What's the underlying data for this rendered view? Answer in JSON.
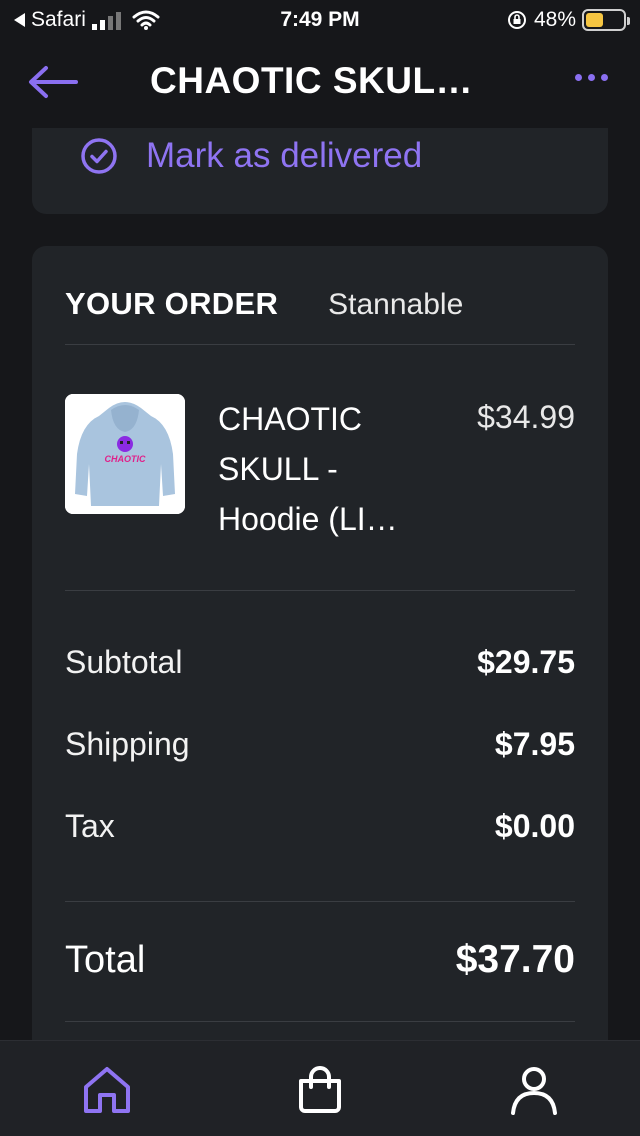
{
  "status_bar": {
    "back_app": "Safari",
    "time": "7:49 PM",
    "battery": "48%",
    "battery_level": 0.48
  },
  "nav": {
    "title": "CHAOTIC SKUL…",
    "back_icon": "arrow-left-icon",
    "more_icon": "more-dots-icon"
  },
  "delivery": {
    "mark_delivered_label": "Mark as delivered",
    "icon": "check-circle-icon"
  },
  "order": {
    "heading": "YOUR ORDER",
    "store": "Stannable",
    "item": {
      "name": "CHAOTIC SKULL - Hoodie (LI…",
      "price": "$34.99",
      "thumb_text": "CHAOTIC"
    },
    "summary": {
      "subtotal_label": "Subtotal",
      "subtotal_value": "$29.75",
      "shipping_label": "Shipping",
      "shipping_value": "$7.95",
      "tax_label": "Tax",
      "tax_value": "$0.00",
      "total_label": "Total",
      "total_value": "$37.70"
    }
  },
  "tab_bar": {
    "items": [
      {
        "icon": "home-icon",
        "active": true
      },
      {
        "icon": "shopping-bag-icon",
        "active": false
      },
      {
        "icon": "profile-icon",
        "active": false
      }
    ]
  },
  "colors": {
    "accent": "#8f74f2",
    "background": "#16171a",
    "card": "#212428",
    "battery": "#f5c542"
  }
}
